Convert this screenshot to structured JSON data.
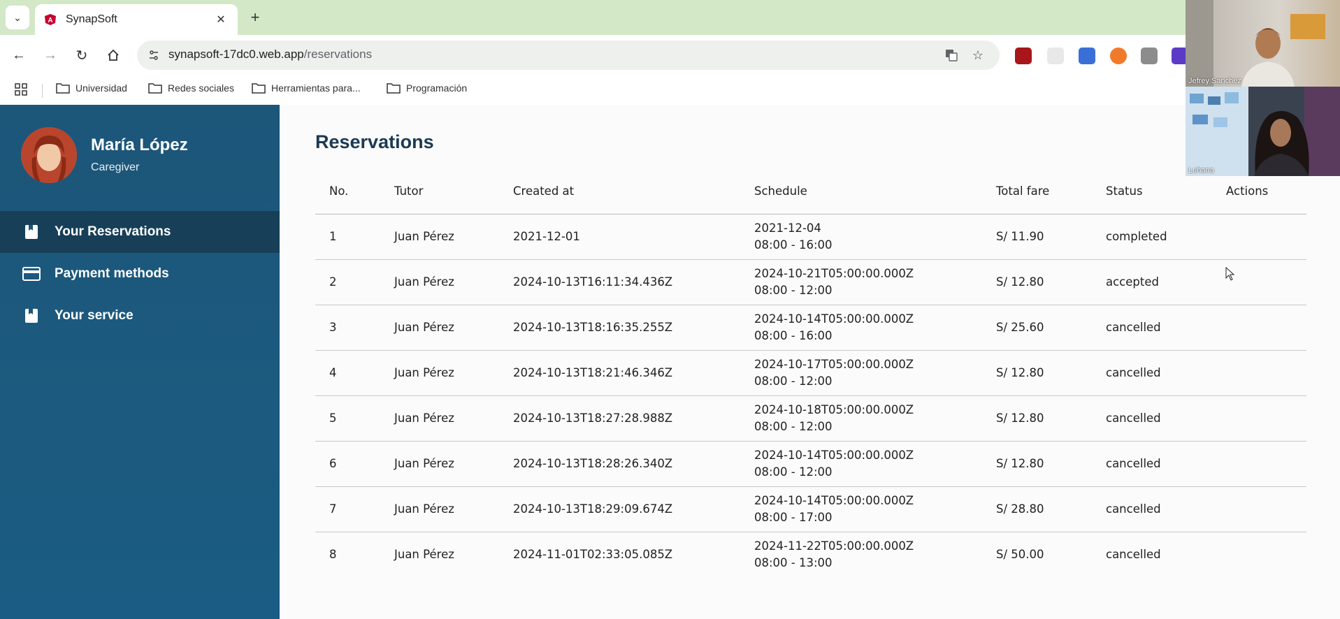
{
  "browser": {
    "tab_title": "SynapSoft",
    "url_host": "synapsoft-17dc0.web.app",
    "url_path": "/reservations",
    "bookmarks": [
      "Universidad",
      "Redes sociales",
      "Herramientas para...",
      "Programación"
    ]
  },
  "sidebar": {
    "user_name": "María López",
    "user_role": "Caregiver",
    "items": [
      {
        "label": "Your Reservations",
        "icon": "book-icon",
        "active": true
      },
      {
        "label": "Payment methods",
        "icon": "credit-card-icon",
        "active": false
      },
      {
        "label": "Your service",
        "icon": "book-icon",
        "active": false
      }
    ]
  },
  "main": {
    "title": "Reservations",
    "columns": [
      "No.",
      "Tutor",
      "Created at",
      "Schedule",
      "Total fare",
      "Status",
      "Actions"
    ],
    "rows": [
      {
        "no": "1",
        "tutor": "Juan Pérez",
        "created": "2021-12-01",
        "date": "2021-12-04",
        "hours": "08:00 - 16:00",
        "fare": "S/ 11.90",
        "status": "completed"
      },
      {
        "no": "2",
        "tutor": "Juan Pérez",
        "created": "2024-10-13T16:11:34.436Z",
        "date": "2024-10-21T05:00:00.000Z",
        "hours": "08:00 - 12:00",
        "fare": "S/ 12.80",
        "status": "accepted"
      },
      {
        "no": "3",
        "tutor": "Juan Pérez",
        "created": "2024-10-13T18:16:35.255Z",
        "date": "2024-10-14T05:00:00.000Z",
        "hours": "08:00 - 16:00",
        "fare": "S/ 25.60",
        "status": "cancelled"
      },
      {
        "no": "4",
        "tutor": "Juan Pérez",
        "created": "2024-10-13T18:21:46.346Z",
        "date": "2024-10-17T05:00:00.000Z",
        "hours": "08:00 - 12:00",
        "fare": "S/ 12.80",
        "status": "cancelled"
      },
      {
        "no": "5",
        "tutor": "Juan Pérez",
        "created": "2024-10-13T18:27:28.988Z",
        "date": "2024-10-18T05:00:00.000Z",
        "hours": "08:00 - 12:00",
        "fare": "S/ 12.80",
        "status": "cancelled"
      },
      {
        "no": "6",
        "tutor": "Juan Pérez",
        "created": "2024-10-13T18:28:26.340Z",
        "date": "2024-10-14T05:00:00.000Z",
        "hours": "08:00 - 12:00",
        "fare": "S/ 12.80",
        "status": "cancelled"
      },
      {
        "no": "7",
        "tutor": "Juan Pérez",
        "created": "2024-10-13T18:29:09.674Z",
        "date": "2024-10-14T05:00:00.000Z",
        "hours": "08:00 - 17:00",
        "fare": "S/ 28.80",
        "status": "cancelled"
      },
      {
        "no": "8",
        "tutor": "Juan Pérez",
        "created": "2024-11-01T02:33:05.085Z",
        "date": "2024-11-22T05:00:00.000Z",
        "hours": "08:00 - 13:00",
        "fare": "S/ 50.00",
        "status": "cancelled"
      }
    ]
  },
  "video_call": {
    "participants": [
      "Jefrey Sanchez",
      "Luhana"
    ]
  },
  "colors": {
    "tabbar": "#d3e8c7",
    "sidebar": "#1c5679",
    "sidebar_active": "#173f58",
    "title": "#1c3a52"
  }
}
